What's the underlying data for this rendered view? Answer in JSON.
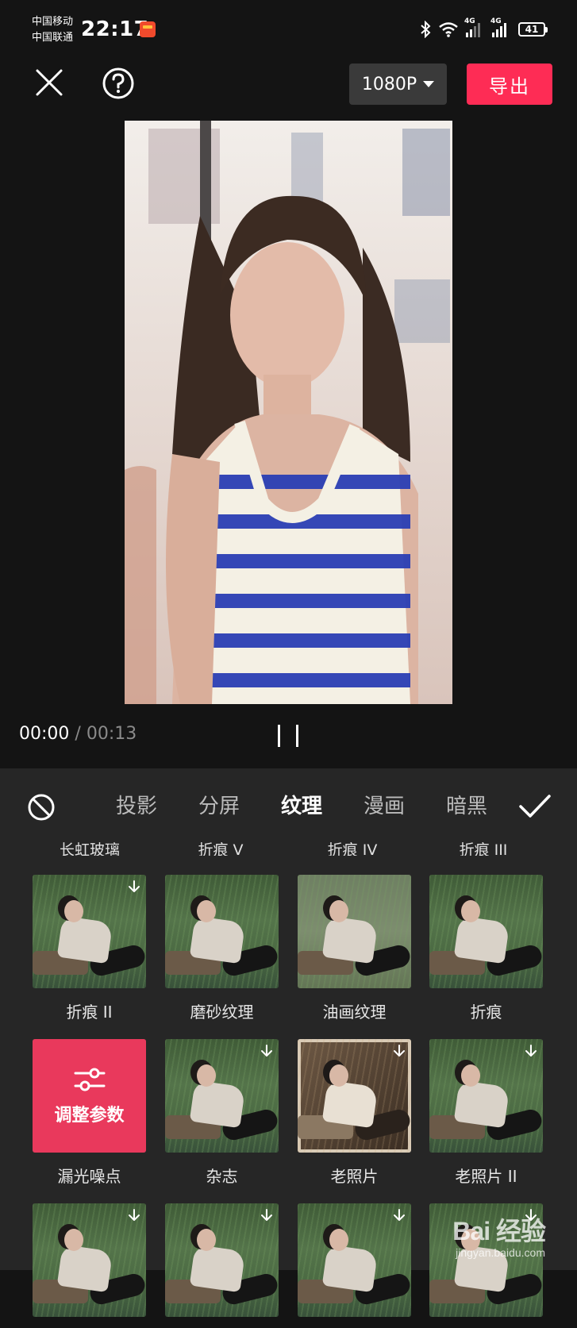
{
  "status_bar": {
    "carrier_1": "中国移动",
    "carrier_2": "中国联通",
    "time": "22:17",
    "net_1": "4G",
    "net_2": "4G",
    "battery": "41"
  },
  "top_bar": {
    "resolution": "1080P",
    "export_label": "导出"
  },
  "player": {
    "current_time": "00:00",
    "separator": "/",
    "total_time": "00:13"
  },
  "effects": {
    "tabs": [
      {
        "label": "投影",
        "active": false
      },
      {
        "label": "分屏",
        "active": false
      },
      {
        "label": "纹理",
        "active": true
      },
      {
        "label": "漫画",
        "active": false
      },
      {
        "label": "暗黑",
        "active": false
      }
    ],
    "previous_row_labels": [
      "长虹玻璃",
      "折痕 V",
      "折痕 IV",
      "折痕 III"
    ],
    "items": [
      {
        "label": "折痕 II",
        "download": true
      },
      {
        "label": "磨砂纹理",
        "download": false
      },
      {
        "label": "油画纹理",
        "download": false
      },
      {
        "label": "折痕",
        "download": false
      },
      {
        "label": "漏光噪点",
        "download": false,
        "selected": true,
        "overlay": "调整参数"
      },
      {
        "label": "杂志",
        "download": true
      },
      {
        "label": "老照片",
        "download": true
      },
      {
        "label": "老照片 II",
        "download": true
      },
      {
        "label": "",
        "download": true
      },
      {
        "label": "",
        "download": true
      },
      {
        "label": "",
        "download": true
      },
      {
        "label": "",
        "download": true
      }
    ]
  },
  "watermark": {
    "main": "Bai 经验",
    "sub": "jingyan.baidu.com"
  }
}
